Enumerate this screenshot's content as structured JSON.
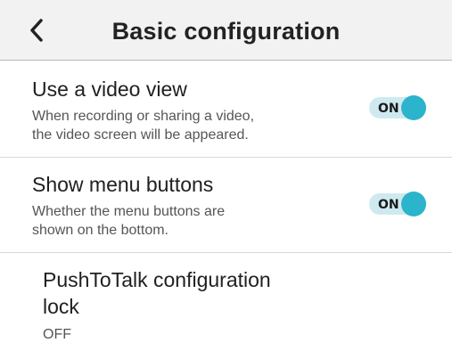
{
  "header": {
    "title": "Basic configuration",
    "back_icon": "chevron-left-icon"
  },
  "settings": [
    {
      "title": "Use a video view",
      "description_line1": "When recording or sharing a video,",
      "description_line2": "the video screen will be appeared.",
      "toggle_label": "ON"
    },
    {
      "title": "Show menu buttons",
      "description_line1": "Whether the menu buttons are",
      "description_line2": "shown on the bottom.",
      "toggle_label": "ON"
    },
    {
      "title_line1": "PushToTalk configuration",
      "title_line2": "lock",
      "value": "OFF"
    }
  ],
  "colors": {
    "accent": "#2bb4cc",
    "toggle_track": "#cfe9f1",
    "header_bg": "#f2f2f2"
  }
}
